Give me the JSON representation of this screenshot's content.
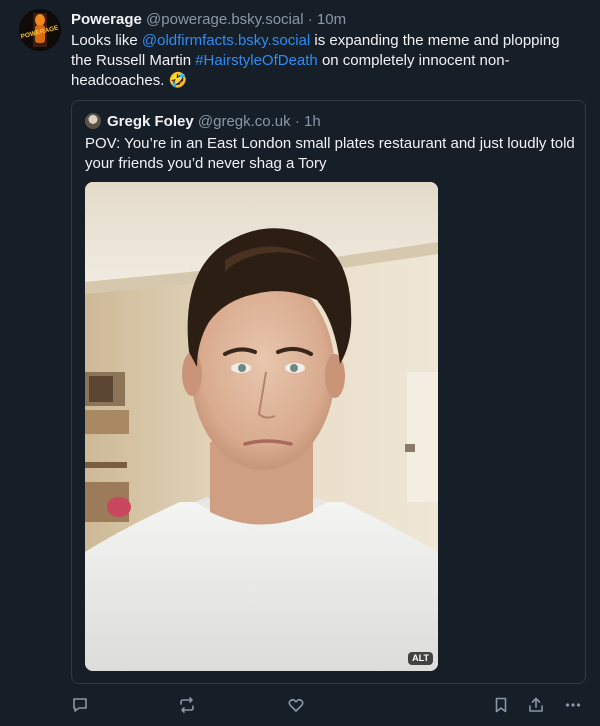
{
  "post": {
    "author": {
      "display_name": "Powerage",
      "handle": "@powerage.bsky.social",
      "avatar_text": "POWERAGE"
    },
    "separator": "·",
    "time": "10m",
    "text": {
      "part1": "Looks like ",
      "mention": "@oldfirmfacts.bsky.social",
      "part2": " is expanding the meme and plopping the Russell Martin ",
      "hashtag": "#HairstyleOfDeath",
      "part3": " on completely innocent non-headcoaches. ",
      "emoji": "🤣"
    }
  },
  "quote": {
    "author": {
      "display_name": "Gregk Foley",
      "handle": "@gregk.co.uk"
    },
    "separator": "·",
    "time": "1h",
    "text": "POV: You’re in an East London small plates restaurant and just loudly told your friends you’d never shag a Tory",
    "image_alt_badge": "ALT"
  },
  "actions": {
    "reply_icon": "reply-icon",
    "repost_icon": "repost-icon",
    "like_icon": "heart-icon",
    "bookmark_icon": "bookmark-icon",
    "share_icon": "share-icon",
    "more_icon": "more-icon"
  },
  "colors": {
    "background": "#161e27",
    "text": "#f1f3f5",
    "muted": "#8a97a6",
    "link": "#2f8cf5",
    "border": "#2e3944"
  }
}
